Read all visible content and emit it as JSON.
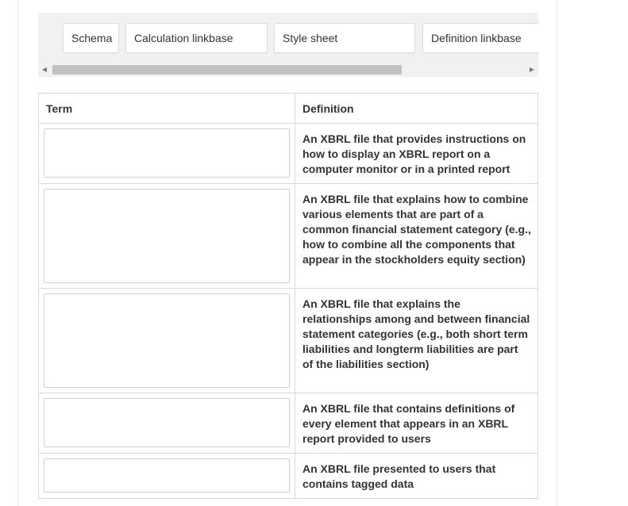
{
  "term_bank": {
    "chips": [
      {
        "label": "Schema"
      },
      {
        "label": "Calculation linkbase"
      },
      {
        "label": "Style sheet"
      },
      {
        "label": "Definition linkbase"
      }
    ],
    "scroll_position": 0.0
  },
  "table": {
    "headers": {
      "term": "Term",
      "definition": "Definition"
    },
    "rows": [
      {
        "term_value": "",
        "definition": "An XBRL file that provides instructions on how to display an XBRL report on a computer monitor or in a printed report"
      },
      {
        "term_value": "",
        "definition": "An XBRL file that explains how to combine various elements that are part of a common financial statement category (e.g., how to combine all the components that appear in the stockholders equity section)"
      },
      {
        "term_value": "",
        "definition": "An XBRL file that explains the relationships among and between financial statement categories (e.g., both short term liabilities and longterm liabilities are part of the liabilities section)"
      },
      {
        "term_value": "",
        "definition": "An XBRL file that contains definitions of every element that appears in an XBRL report provided to users"
      },
      {
        "term_value": "",
        "definition": "An XBRL file presented to users that contains tagged data"
      }
    ]
  }
}
